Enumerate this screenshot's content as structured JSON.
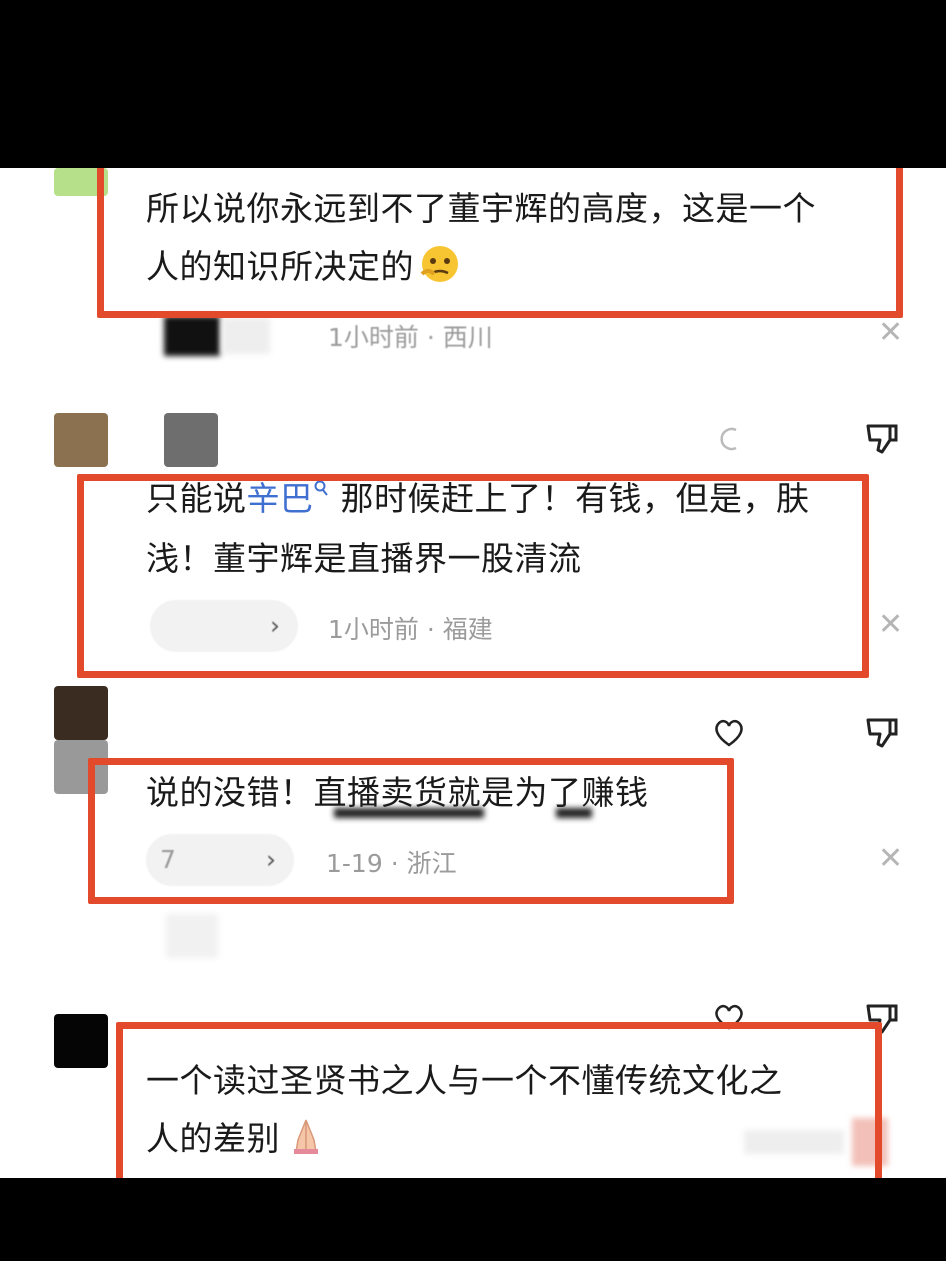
{
  "comments": [
    {
      "text": "所以说你永远到不了董宇辉的高度，这是一个",
      "text2": "人的知识所决定的",
      "emoji": "thinking-face-emoji",
      "time": "1小时前",
      "location": "西川"
    },
    {
      "text_before": "只能说",
      "mention": "辛巴",
      "text_after": " 那时候赶上了！有钱，但是，肤",
      "text2": "浅！董宇辉是直播界一股清流",
      "reply_label": "",
      "time": "1小时前",
      "location": "福建"
    },
    {
      "text": "说的没错！直播卖货就是为了赚钱",
      "reply_label": "7",
      "time": "1-19",
      "location": "浙江"
    },
    {
      "text": "一个读过圣贤书之人与一个不懂传统文化之",
      "text2": "人的差别",
      "emoji": "folded-hands-emoji"
    }
  ],
  "separator": "·",
  "colors": {
    "highlight_box": "#e24a2b",
    "mention": "#3f6fd0",
    "meta_text": "#9b9b9b"
  }
}
